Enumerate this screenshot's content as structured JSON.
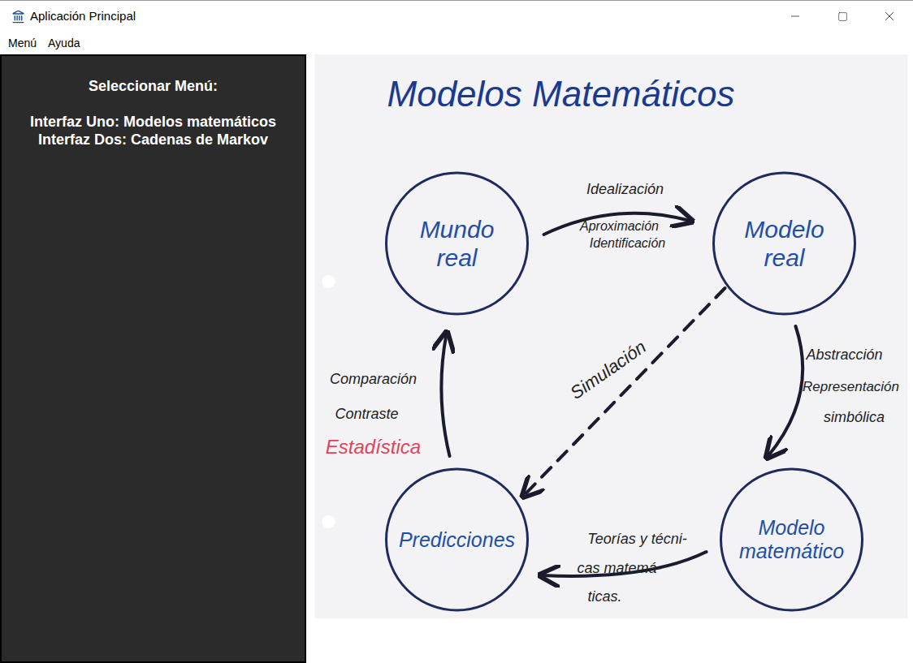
{
  "window": {
    "title": "Aplicación Principal"
  },
  "menu_bar": [
    {
      "label": "Menú"
    },
    {
      "label": "Ayuda"
    }
  ],
  "sidebar": {
    "heading": "Seleccionar Menú:",
    "items": [
      {
        "label": "Interfaz Uno: Modelos matemáticos"
      },
      {
        "label": "Interfaz Dos: Cadenas de Markov"
      }
    ]
  },
  "diagram": {
    "title": "Modelos Matemáticos",
    "nodes": [
      {
        "lines": [
          "Mundo",
          "real"
        ]
      },
      {
        "lines": [
          "Modelo",
          "real"
        ]
      },
      {
        "lines": [
          "Predicciones"
        ]
      },
      {
        "lines": [
          "Modelo",
          "matemático"
        ]
      }
    ],
    "edges": [
      {
        "kind": "solid",
        "labels": [
          {
            "text": "Idealización",
            "color": "#222222"
          },
          {
            "text": "Aproximación",
            "color": "#222222"
          },
          {
            "text": "Identificación",
            "color": "#222222"
          }
        ]
      },
      {
        "kind": "solid",
        "labels": [
          {
            "text": "Abstracción",
            "color": "#222222"
          },
          {
            "text": "Representación",
            "color": "#222222"
          },
          {
            "text": "simbólica",
            "color": "#222222"
          }
        ]
      },
      {
        "kind": "solid",
        "labels": [
          {
            "text": "Teorías y técni-",
            "color": "#222222"
          },
          {
            "text": "cas matemá-",
            "color": "#222222"
          },
          {
            "text": "ticas.",
            "color": "#222222"
          }
        ]
      },
      {
        "kind": "solid",
        "labels": [
          {
            "text": "Comparación",
            "color": "#222222"
          },
          {
            "text": "Contraste",
            "color": "#222222"
          },
          {
            "text": "Estadística",
            "color": "#e0445a"
          }
        ]
      },
      {
        "kind": "dashed",
        "labels": [
          {
            "text": "Simulación",
            "color": "#222222"
          }
        ]
      }
    ]
  }
}
